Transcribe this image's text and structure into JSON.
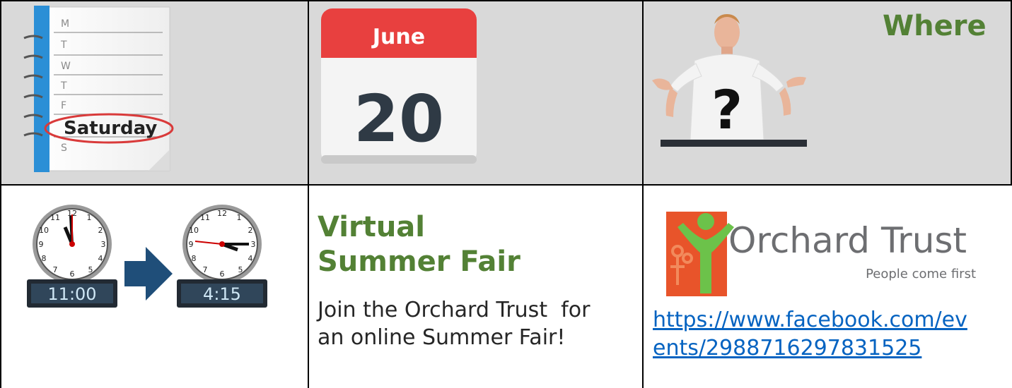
{
  "calendar": {
    "days": [
      "M",
      "T",
      "W",
      "T",
      "F",
      "S"
    ],
    "highlighted_day": "Saturday"
  },
  "date": {
    "month": "June",
    "day": "20"
  },
  "where": {
    "title": "Where"
  },
  "time": {
    "start": "11:00",
    "end": "4:15"
  },
  "event": {
    "title_line1": "Virtual",
    "title_line2": "Summer Fair",
    "description_line1": "Join the Orchard Trust  for",
    "description_line2": "an online Summer Fair!"
  },
  "org": {
    "name": "Orchard Trust",
    "tagline": "People come first",
    "link_line1": "https://www.facebook.com/ev",
    "link_line2": "ents/2988716297831525"
  },
  "colors": {
    "heading_green": "#538135",
    "link_blue": "#0563c1",
    "row_bg": "#d9d9d9",
    "calendar_red": "#e8403f",
    "orchard_orange": "#e8542a"
  }
}
